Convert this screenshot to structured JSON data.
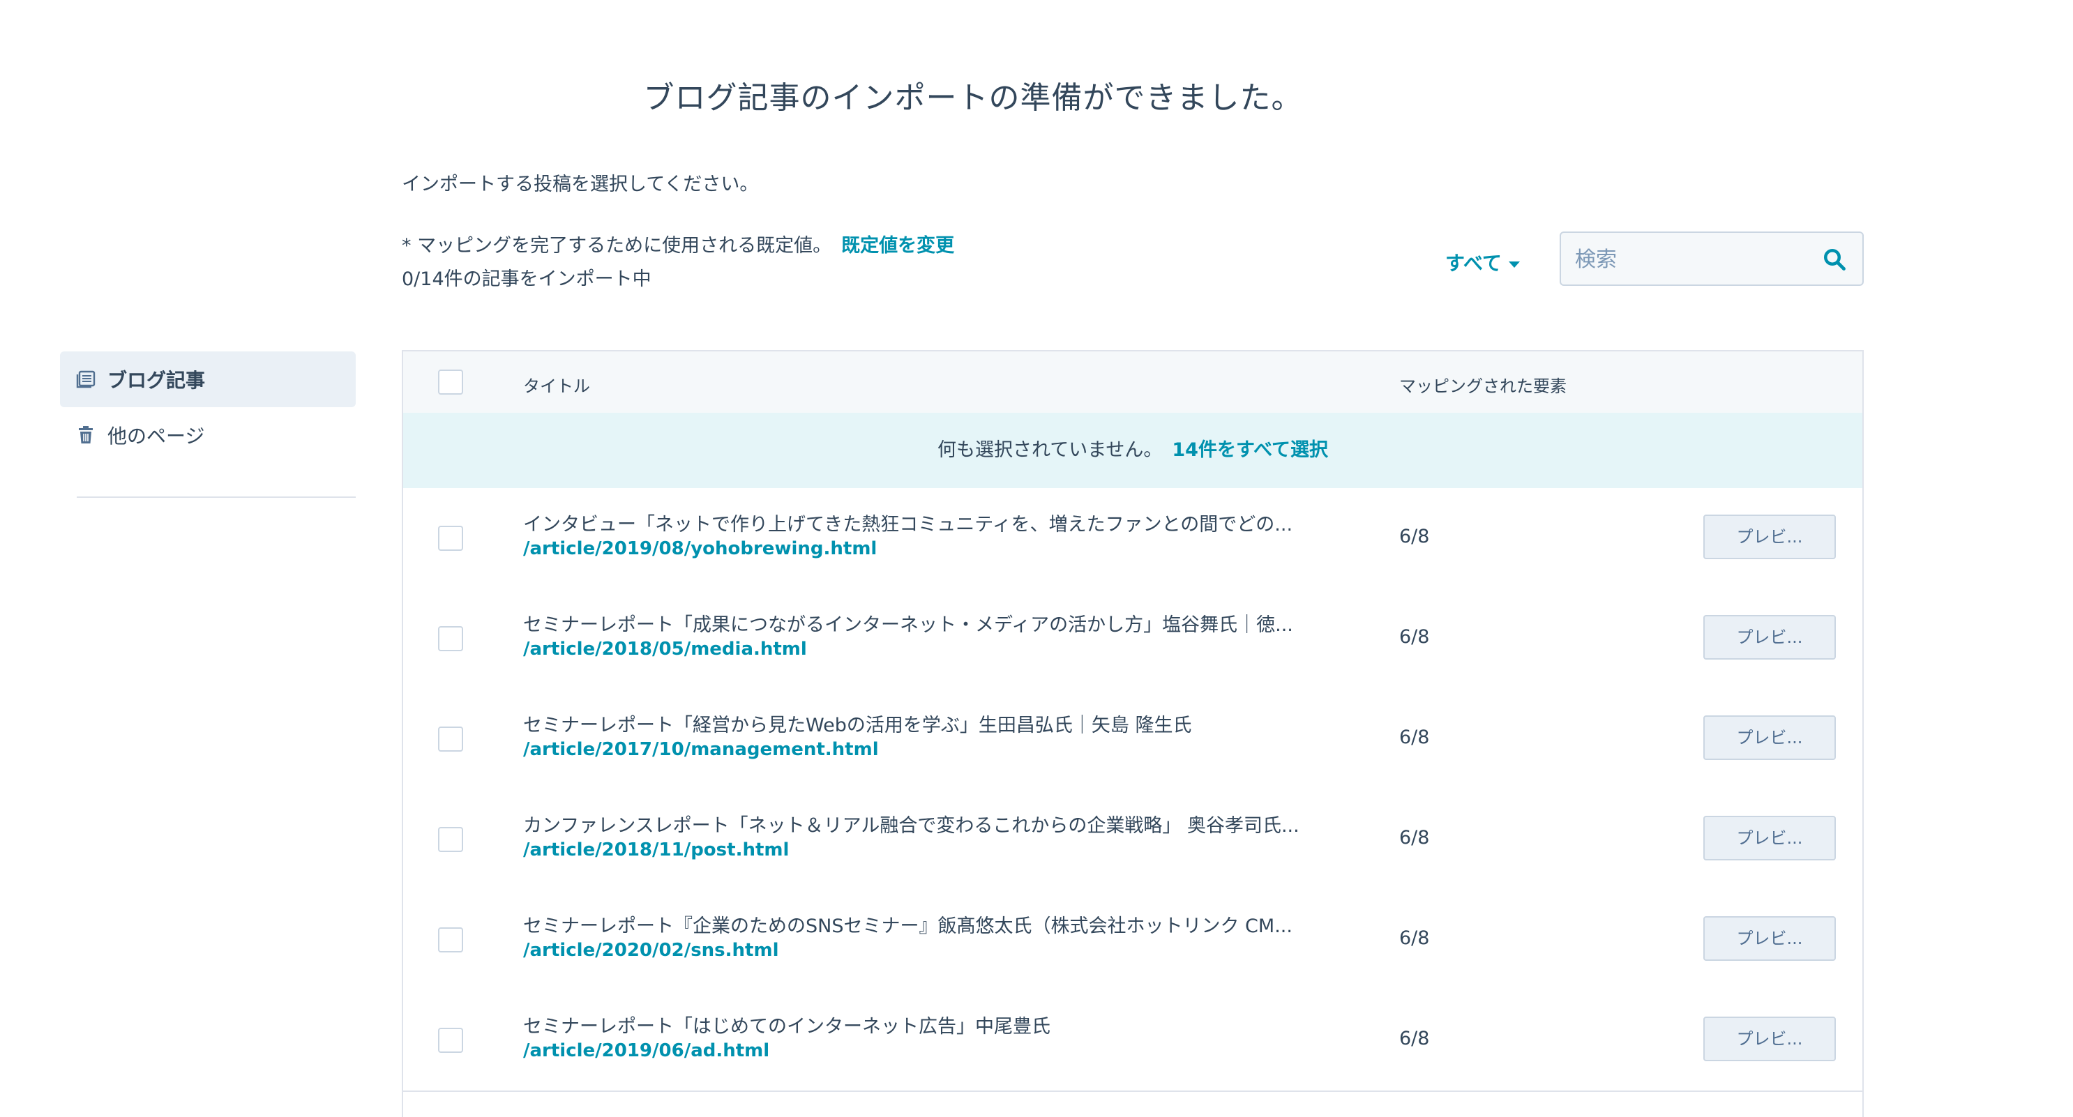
{
  "page": {
    "title": "ブログ記事のインポートの準備ができました。",
    "instruction": "インポートする投稿を選択してください。",
    "mapping_note": "* マッピングを完了するために使用される既定値。",
    "change_default_link": "既定値を変更",
    "import_count": "0/14件の記事をインポート中"
  },
  "filter": {
    "label": "すべて"
  },
  "search": {
    "placeholder": "検索",
    "value": ""
  },
  "sidebar": {
    "items": [
      {
        "label": "ブログ記事",
        "icon": "blog-list-icon",
        "active": true
      },
      {
        "label": "他のページ",
        "icon": "trash-icon",
        "active": false
      }
    ]
  },
  "table": {
    "columns": {
      "title": "タイトル",
      "mapped": "マッピングされた要素"
    },
    "banner": {
      "text": "何も選択されていません。",
      "select_all": "14件をすべて選択"
    },
    "preview_label": "プレビ...",
    "rows": [
      {
        "title": "インタビュー「ネットで作り上げてきた熱狂コミュニティを、増えたファンとの間でどの...",
        "url": "/article/2019/08/yohobrewing.html",
        "mapped": "6/8"
      },
      {
        "title": "セミナーレポート「成果につながるインターネット・メディアの活かし方」塩谷舞氏｜徳...",
        "url": "/article/2018/05/media.html",
        "mapped": "6/8"
      },
      {
        "title": "セミナーレポート「経営から見たWebの活用を学ぶ」生田昌弘氏｜矢島 隆生氏",
        "url": "/article/2017/10/management.html",
        "mapped": "6/8"
      },
      {
        "title": "カンファレンスレポート「ネット＆リアル融合で変わるこれからの企業戦略」 奥谷孝司氏...",
        "url": "/article/2018/11/post.html",
        "mapped": "6/8"
      },
      {
        "title": "セミナーレポート『企業のためのSNSセミナー』飯髙悠太氏（株式会社ホットリンク CM...",
        "url": "/article/2020/02/sns.html",
        "mapped": "6/8"
      },
      {
        "title": "セミナーレポート「はじめてのインターネット広告」中尾豊氏",
        "url": "/article/2019/06/ad.html",
        "mapped": "6/8"
      }
    ]
  },
  "colors": {
    "accent": "#0091ae",
    "text": "#33475b",
    "banner": "#e5f5f8",
    "sidebar_active": "#eaf0f6"
  }
}
